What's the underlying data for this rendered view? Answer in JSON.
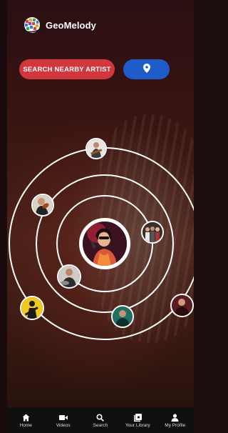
{
  "app": {
    "name": "GeoMelody"
  },
  "search": {
    "button_label": "SEARCH NEARBY ARTIST"
  },
  "colors": {
    "search_button": "#d2373d",
    "location_button": "#1e5cc9",
    "nav_bg": "#0f0f10"
  },
  "icons": {
    "location": "location-pin-icon",
    "logo": "globe-logo-icon"
  },
  "nav": {
    "items": [
      {
        "label": "Home",
        "icon": "home-icon"
      },
      {
        "label": "Videos",
        "icon": "video-camera-icon"
      },
      {
        "label": "Search",
        "icon": "search-icon"
      },
      {
        "label": "Your Library",
        "icon": "library-icon"
      },
      {
        "label": "My Profile",
        "icon": "profile-icon"
      }
    ]
  }
}
